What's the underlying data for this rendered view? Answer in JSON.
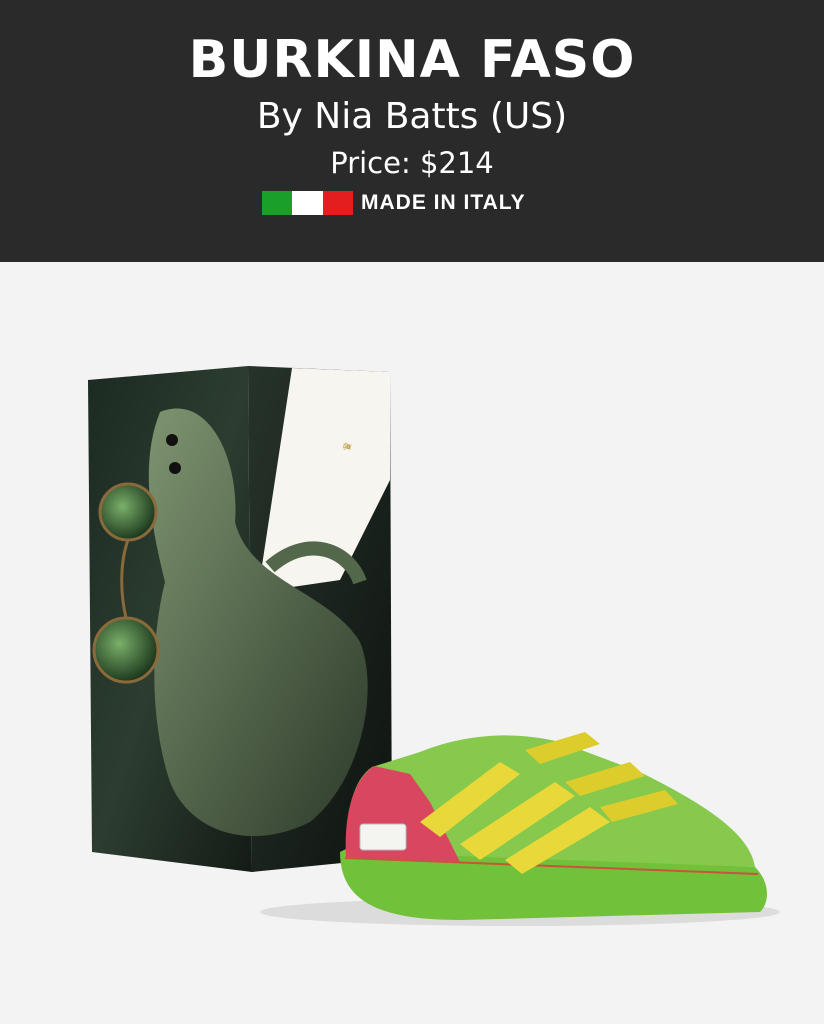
{
  "header": {
    "title": "BURKINA FASO",
    "byline": "By Nia Batts (US)",
    "price": "Price: $214",
    "made_in": "MADE IN ITALY"
  },
  "flag_colors": [
    "#1aa02a",
    "#ffffff",
    "#e41e1e"
  ],
  "colors": {
    "header_bg": "#2a2a2a",
    "page_bg": "#f3f3f3",
    "shoe_green": "#7fc84a",
    "shoe_pink": "#d8465f",
    "strap_yellow": "#e8d83a"
  }
}
